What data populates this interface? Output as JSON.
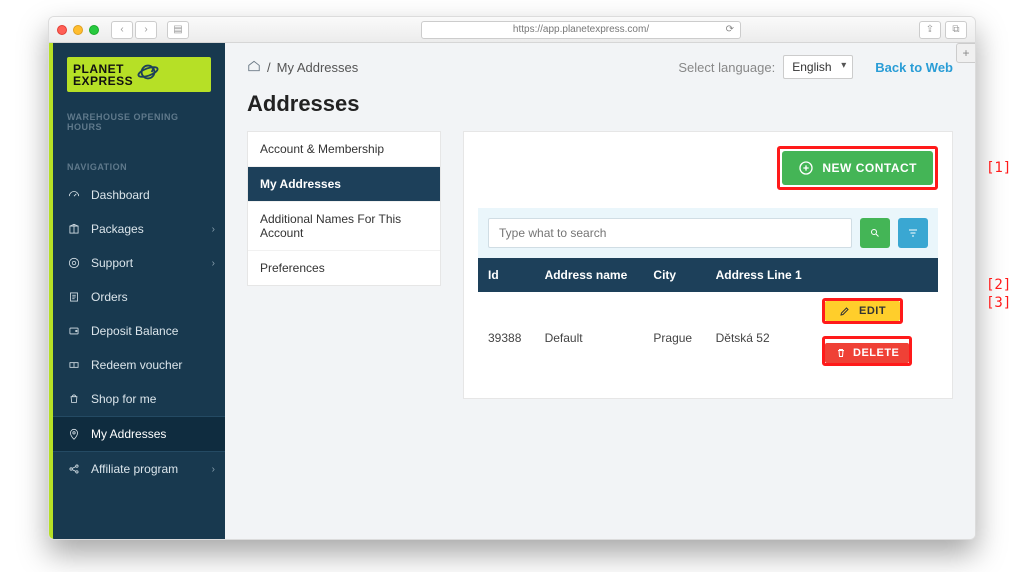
{
  "browser": {
    "url": "https://app.planetexpress.com/"
  },
  "logo": {
    "line1": "PLANET",
    "line2": "EXPRESS"
  },
  "sidebar": {
    "section_hours": "WAREHOUSE OPENING HOURS",
    "section_nav": "NAVIGATION",
    "items": [
      {
        "label": "Dashboard"
      },
      {
        "label": "Packages"
      },
      {
        "label": "Support"
      },
      {
        "label": "Orders"
      },
      {
        "label": "Deposit Balance"
      },
      {
        "label": "Redeem voucher"
      },
      {
        "label": "Shop for me"
      },
      {
        "label": "My Addresses"
      },
      {
        "label": "Affiliate program"
      }
    ]
  },
  "topbar": {
    "breadcrumb_sep": "/",
    "breadcrumb_current": "My Addresses",
    "lang_label": "Select language:",
    "lang_value": "English",
    "back_to_web": "Back to Web"
  },
  "page": {
    "title": "Addresses"
  },
  "side_menu": {
    "items": [
      {
        "label": "Account & Membership"
      },
      {
        "label": "My Addresses"
      },
      {
        "label": "Additional Names For This Account"
      },
      {
        "label": "Preferences"
      }
    ]
  },
  "buttons": {
    "new_contact": "NEW CONTACT",
    "edit": "EDIT",
    "delete": "DELETE"
  },
  "search": {
    "placeholder": "Type what to search"
  },
  "table": {
    "headers": {
      "id": "Id",
      "name": "Address name",
      "city": "City",
      "line1": "Address Line 1"
    },
    "rows": [
      {
        "id": "39388",
        "name": "Default",
        "city": "Prague",
        "line1": "Dětská 52"
      }
    ]
  },
  "annotations": {
    "a1": "[1]",
    "a2": "[2]",
    "a3": "[3]"
  }
}
